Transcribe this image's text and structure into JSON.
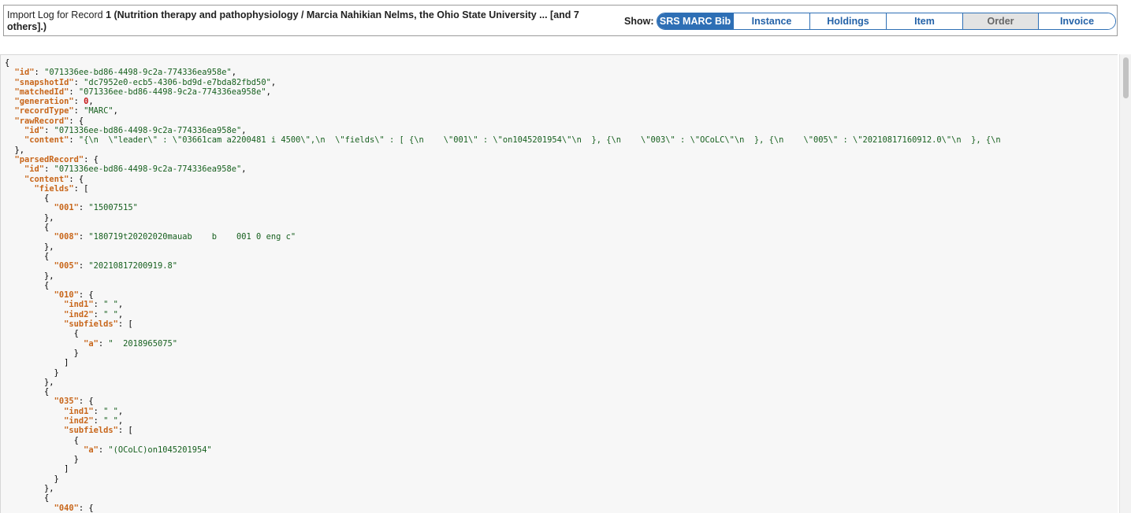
{
  "header": {
    "title_prefix": "Import Log for Record ",
    "title_bold": "1 (Nutrition therapy and pathophysiology / Marcia Nahikian Nelms, the Ohio State University ... [and 7 others].)"
  },
  "show": {
    "label": "Show:",
    "buttons": [
      {
        "label": "SRS MARC Bib",
        "state": "active",
        "width": 97
      },
      {
        "label": "Instance",
        "state": "normal",
        "width": 97
      },
      {
        "label": "Holdings",
        "state": "normal",
        "width": 97
      },
      {
        "label": "Item",
        "state": "normal",
        "width": 97
      },
      {
        "label": "Order",
        "state": "disabled",
        "width": 96
      },
      {
        "label": "Invoice",
        "state": "normal",
        "width": 97
      }
    ]
  },
  "json_lines": [
    [
      {
        "t": "p",
        "v": "{"
      }
    ],
    [
      {
        "t": "p",
        "v": "  "
      },
      {
        "t": "k",
        "v": "\"id\""
      },
      {
        "t": "p",
        "v": ": "
      },
      {
        "t": "s",
        "v": "\"071336ee-bd86-4498-9c2a-774336ea958e\""
      },
      {
        "t": "p",
        "v": ","
      }
    ],
    [
      {
        "t": "p",
        "v": "  "
      },
      {
        "t": "k",
        "v": "\"snapshotId\""
      },
      {
        "t": "p",
        "v": ": "
      },
      {
        "t": "s",
        "v": "\"dc7952e0-ecb5-4306-bd9d-e7bda82fbd50\""
      },
      {
        "t": "p",
        "v": ","
      }
    ],
    [
      {
        "t": "p",
        "v": "  "
      },
      {
        "t": "k",
        "v": "\"matchedId\""
      },
      {
        "t": "p",
        "v": ": "
      },
      {
        "t": "s",
        "v": "\"071336ee-bd86-4498-9c2a-774336ea958e\""
      },
      {
        "t": "p",
        "v": ","
      }
    ],
    [
      {
        "t": "p",
        "v": "  "
      },
      {
        "t": "k",
        "v": "\"generation\""
      },
      {
        "t": "p",
        "v": ": "
      },
      {
        "t": "n",
        "v": "0"
      },
      {
        "t": "p",
        "v": ","
      }
    ],
    [
      {
        "t": "p",
        "v": "  "
      },
      {
        "t": "k",
        "v": "\"recordType\""
      },
      {
        "t": "p",
        "v": ": "
      },
      {
        "t": "s",
        "v": "\"MARC\""
      },
      {
        "t": "p",
        "v": ","
      }
    ],
    [
      {
        "t": "p",
        "v": "  "
      },
      {
        "t": "k",
        "v": "\"rawRecord\""
      },
      {
        "t": "p",
        "v": ": {"
      }
    ],
    [
      {
        "t": "p",
        "v": "    "
      },
      {
        "t": "k",
        "v": "\"id\""
      },
      {
        "t": "p",
        "v": ": "
      },
      {
        "t": "s",
        "v": "\"071336ee-bd86-4498-9c2a-774336ea958e\""
      },
      {
        "t": "p",
        "v": ","
      }
    ],
    [
      {
        "t": "p",
        "v": "    "
      },
      {
        "t": "k",
        "v": "\"content\""
      },
      {
        "t": "p",
        "v": ": "
      },
      {
        "t": "s",
        "v": "\"{\\n  \\\"leader\\\" : \\\"03661cam a2200481 i 4500\\\",\\n  \\\"fields\\\" : [ {\\n    \\\"001\\\" : \\\"on1045201954\\\"\\n  }, {\\n    \\\"003\\\" : \\\"OCoLC\\\"\\n  }, {\\n    \\\"005\\\" : \\\"20210817160912.0\\\"\\n  }, {\\n"
      }
    ],
    [
      {
        "t": "p",
        "v": "  },"
      }
    ],
    [
      {
        "t": "p",
        "v": "  "
      },
      {
        "t": "k",
        "v": "\"parsedRecord\""
      },
      {
        "t": "p",
        "v": ": {"
      }
    ],
    [
      {
        "t": "p",
        "v": "    "
      },
      {
        "t": "k",
        "v": "\"id\""
      },
      {
        "t": "p",
        "v": ": "
      },
      {
        "t": "s",
        "v": "\"071336ee-bd86-4498-9c2a-774336ea958e\""
      },
      {
        "t": "p",
        "v": ","
      }
    ],
    [
      {
        "t": "p",
        "v": "    "
      },
      {
        "t": "k",
        "v": "\"content\""
      },
      {
        "t": "p",
        "v": ": {"
      }
    ],
    [
      {
        "t": "p",
        "v": "      "
      },
      {
        "t": "k",
        "v": "\"fields\""
      },
      {
        "t": "p",
        "v": ": ["
      }
    ],
    [
      {
        "t": "p",
        "v": "        {"
      }
    ],
    [
      {
        "t": "p",
        "v": "          "
      },
      {
        "t": "k",
        "v": "\"001\""
      },
      {
        "t": "p",
        "v": ": "
      },
      {
        "t": "s",
        "v": "\"15007515\""
      }
    ],
    [
      {
        "t": "p",
        "v": "        },"
      }
    ],
    [
      {
        "t": "p",
        "v": "        {"
      }
    ],
    [
      {
        "t": "p",
        "v": "          "
      },
      {
        "t": "k",
        "v": "\"008\""
      },
      {
        "t": "p",
        "v": ": "
      },
      {
        "t": "s",
        "v": "\"180719t20202020mauab    b    001 0 eng c\""
      }
    ],
    [
      {
        "t": "p",
        "v": "        },"
      }
    ],
    [
      {
        "t": "p",
        "v": "        {"
      }
    ],
    [
      {
        "t": "p",
        "v": "          "
      },
      {
        "t": "k",
        "v": "\"005\""
      },
      {
        "t": "p",
        "v": ": "
      },
      {
        "t": "s",
        "v": "\"20210817200919.8\""
      }
    ],
    [
      {
        "t": "p",
        "v": "        },"
      }
    ],
    [
      {
        "t": "p",
        "v": "        {"
      }
    ],
    [
      {
        "t": "p",
        "v": "          "
      },
      {
        "t": "k",
        "v": "\"010\""
      },
      {
        "t": "p",
        "v": ": {"
      }
    ],
    [
      {
        "t": "p",
        "v": "            "
      },
      {
        "t": "k",
        "v": "\"ind1\""
      },
      {
        "t": "p",
        "v": ": "
      },
      {
        "t": "s",
        "v": "\" \""
      },
      {
        "t": "p",
        "v": ","
      }
    ],
    [
      {
        "t": "p",
        "v": "            "
      },
      {
        "t": "k",
        "v": "\"ind2\""
      },
      {
        "t": "p",
        "v": ": "
      },
      {
        "t": "s",
        "v": "\" \""
      },
      {
        "t": "p",
        "v": ","
      }
    ],
    [
      {
        "t": "p",
        "v": "            "
      },
      {
        "t": "k",
        "v": "\"subfields\""
      },
      {
        "t": "p",
        "v": ": ["
      }
    ],
    [
      {
        "t": "p",
        "v": "              {"
      }
    ],
    [
      {
        "t": "p",
        "v": "                "
      },
      {
        "t": "k",
        "v": "\"a\""
      },
      {
        "t": "p",
        "v": ": "
      },
      {
        "t": "s",
        "v": "\"  2018965075\""
      }
    ],
    [
      {
        "t": "p",
        "v": "              }"
      }
    ],
    [
      {
        "t": "p",
        "v": "            ]"
      }
    ],
    [
      {
        "t": "p",
        "v": "          }"
      }
    ],
    [
      {
        "t": "p",
        "v": "        },"
      }
    ],
    [
      {
        "t": "p",
        "v": "        {"
      }
    ],
    [
      {
        "t": "p",
        "v": "          "
      },
      {
        "t": "k",
        "v": "\"035\""
      },
      {
        "t": "p",
        "v": ": {"
      }
    ],
    [
      {
        "t": "p",
        "v": "            "
      },
      {
        "t": "k",
        "v": "\"ind1\""
      },
      {
        "t": "p",
        "v": ": "
      },
      {
        "t": "s",
        "v": "\" \""
      },
      {
        "t": "p",
        "v": ","
      }
    ],
    [
      {
        "t": "p",
        "v": "            "
      },
      {
        "t": "k",
        "v": "\"ind2\""
      },
      {
        "t": "p",
        "v": ": "
      },
      {
        "t": "s",
        "v": "\" \""
      },
      {
        "t": "p",
        "v": ","
      }
    ],
    [
      {
        "t": "p",
        "v": "            "
      },
      {
        "t": "k",
        "v": "\"subfields\""
      },
      {
        "t": "p",
        "v": ": ["
      }
    ],
    [
      {
        "t": "p",
        "v": "              {"
      }
    ],
    [
      {
        "t": "p",
        "v": "                "
      },
      {
        "t": "k",
        "v": "\"a\""
      },
      {
        "t": "p",
        "v": ": "
      },
      {
        "t": "s",
        "v": "\"(OCoLC)on1045201954\""
      }
    ],
    [
      {
        "t": "p",
        "v": "              }"
      }
    ],
    [
      {
        "t": "p",
        "v": "            ]"
      }
    ],
    [
      {
        "t": "p",
        "v": "          }"
      }
    ],
    [
      {
        "t": "p",
        "v": "        },"
      }
    ],
    [
      {
        "t": "p",
        "v": "        {"
      }
    ],
    [
      {
        "t": "p",
        "v": "          "
      },
      {
        "t": "k",
        "v": "\"040\""
      },
      {
        "t": "p",
        "v": ": {"
      }
    ]
  ]
}
